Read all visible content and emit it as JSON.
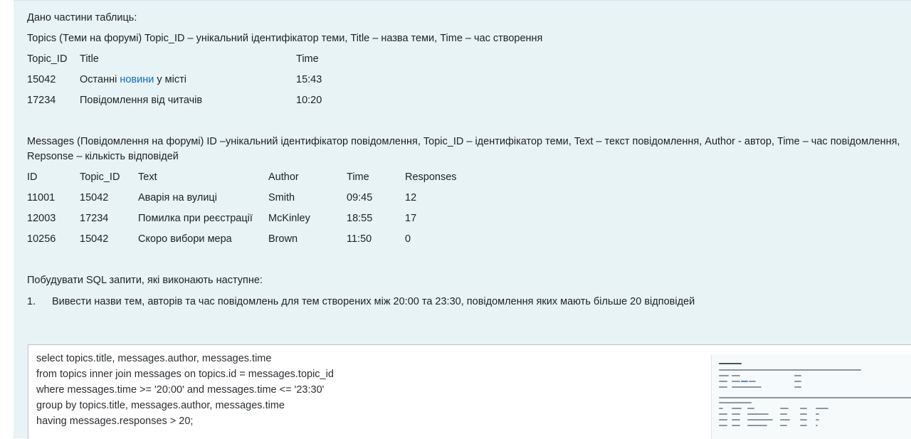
{
  "intro": "Дано частини таблиць:",
  "topics": {
    "description": "Topics (Теми на форумі) Topic_ID – унікальний ідентифікатор теми, Title – назва теми, Time – час створення",
    "headers": [
      "Topic_ID",
      "Title",
      "Time"
    ],
    "rows": [
      {
        "id": "15042",
        "title_before": "Останні ",
        "title_link": "новини",
        "title_after": " у місті",
        "time": "15:43"
      },
      {
        "id": "17234",
        "title": "Повідомлення від читачів",
        "time": "10:20"
      }
    ]
  },
  "messages": {
    "description_line1": "Messages (Повідомлення на форумі) ID –унікальний ідентифікатор повідомлення, Topic_ID – ідентифікатор теми, Text – текст повідомлення, Author - автор, Time – час повідомлення,",
    "description_line2": "Repsonse – кількість відповідей",
    "headers": [
      "ID",
      "Topic_ID",
      "Text",
      "Author",
      "Time",
      "Responses"
    ],
    "rows": [
      [
        "11001",
        "15042",
        "Аварія на вулиці",
        "Smith",
        "09:45",
        "12"
      ],
      [
        "12003",
        "17234",
        "Помилка при реєстрації",
        "McKinley",
        "18:55",
        "17"
      ],
      [
        "10256",
        "15042",
        "Скоро вибори мера",
        "Brown",
        "11:50",
        "0"
      ]
    ]
  },
  "task": {
    "heading": "Побудувати SQL запити, які виконають наступне:",
    "items": [
      {
        "number": "1.",
        "text": "Вивести назви тем, авторів та час повідомлень для тем створених між 20:00 та 23:30, повідомлення яких мають більше 20 відповідей"
      }
    ]
  },
  "answer": {
    "code_lines": [
      "select topics.title, messages.author, messages.time",
      "from topics inner join messages on topics.id = messages.topic_id",
      "where messages.time >= '20:00' and messages.time <= '23:30'",
      "group by topics.title, messages.author, messages.time",
      "having messages.responses > 20;"
    ],
    "thumbnail_icon": "attached-screenshot-thumbnail"
  }
}
